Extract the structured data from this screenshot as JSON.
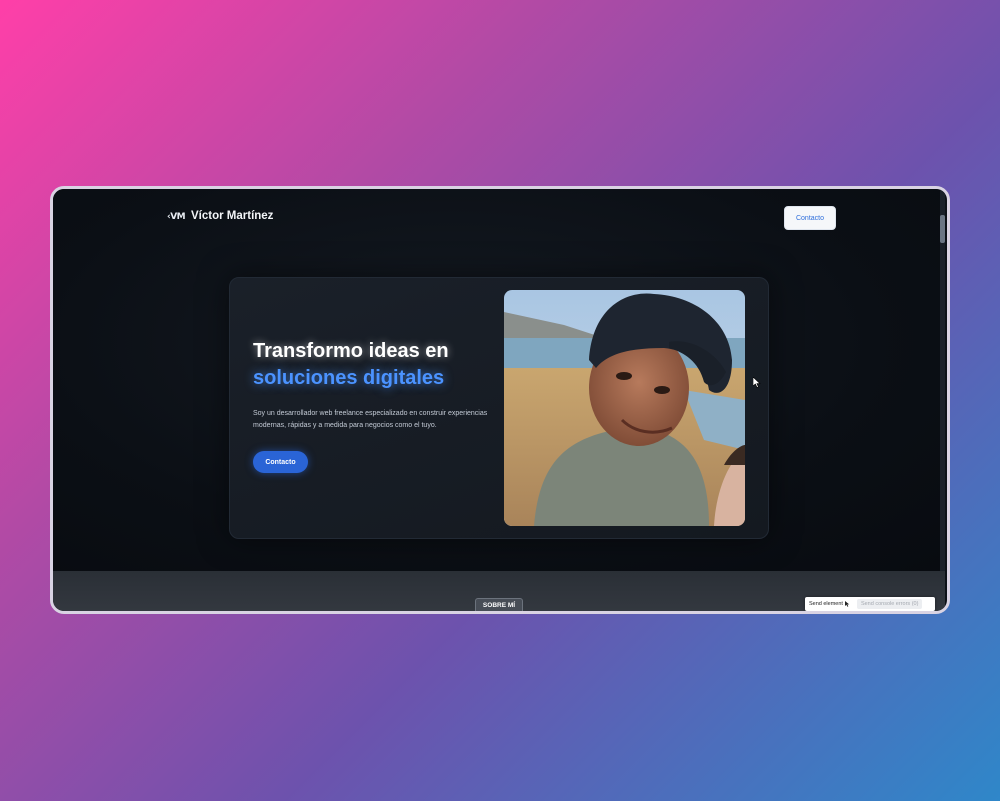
{
  "header": {
    "logo": "‹VM",
    "brand_name": "Víctor Martínez",
    "contact_label": "Contacto"
  },
  "hero": {
    "title_line1": "Transformo ideas en",
    "title_line2": "soluciones digitales",
    "description": "Soy un desarrollador web freelance especializado en construir experiencias modernas, rápidas y a medida para negocios como el tuyo.",
    "cta_label": "Contacto",
    "photo_icon": "portrait-photo"
  },
  "section_tab": "SOBRE MÍ",
  "devtools": {
    "send_element": "Send element",
    "send_errors": "Send console errors (0)"
  },
  "colors": {
    "accent": "#4b93ff",
    "button": "#2a64d6",
    "background": "#0b0f15"
  }
}
